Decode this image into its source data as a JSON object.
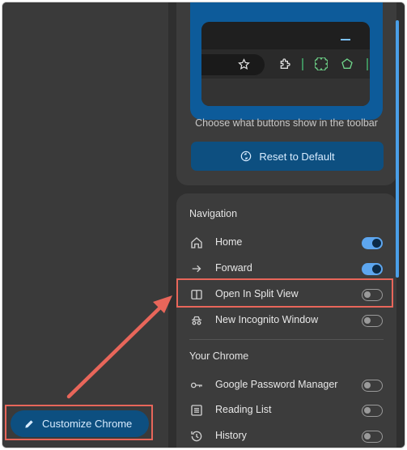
{
  "panel": {
    "toolbar_caption": "Choose what buttons show in the toolbar",
    "reset_label": "Reset to Default"
  },
  "navigation": {
    "title": "Navigation",
    "items": [
      {
        "label": "Home",
        "icon": "home-icon",
        "on": true
      },
      {
        "label": "Forward",
        "icon": "forward-arrow-icon",
        "on": true
      },
      {
        "label": "Open In Split View",
        "icon": "split-view-icon",
        "on": false
      },
      {
        "label": "New Incognito Window",
        "icon": "incognito-icon",
        "on": false
      }
    ]
  },
  "your_chrome": {
    "title": "Your Chrome",
    "items": [
      {
        "label": "Google Password Manager",
        "icon": "key-icon",
        "on": false
      },
      {
        "label": "Reading List",
        "icon": "reading-list-icon",
        "on": false
      },
      {
        "label": "History",
        "icon": "history-icon",
        "on": false
      }
    ]
  },
  "customize_label": "Customize Chrome",
  "colors": {
    "accent_blue": "#0d4f80",
    "toggle_on": "#5da6ef",
    "highlight": "#e8665a",
    "preview_bg": "#0d5b9a"
  }
}
